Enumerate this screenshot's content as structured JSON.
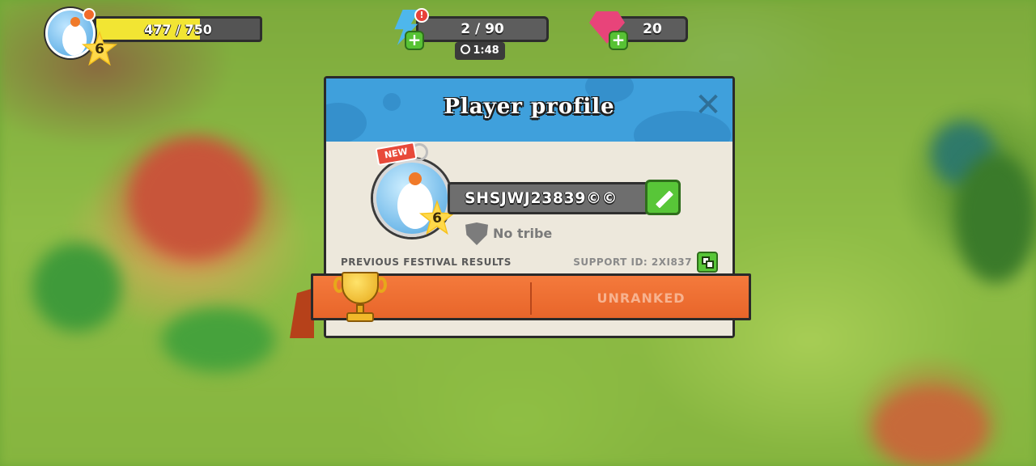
{
  "hud": {
    "xp_text": "477 / 750",
    "xp_progress": 0.636,
    "level": "6",
    "energy_text": "2 / 90",
    "energy_timer": "1:48",
    "gems": "20"
  },
  "dialog": {
    "title": "Player profile",
    "new_badge": "NEW",
    "player_level": "6",
    "player_name": "SHSJWJ23839©©",
    "tribe": "No tribe",
    "festival_label": "PREVIOUS FESTIVAL RESULTS",
    "support_label": "SUPPORT ID: 2XI837",
    "festival_rank": "UNRANKED",
    "close_glyph": "✕"
  },
  "colors": {
    "header_blue": "#3fa0dc",
    "ribbon_orange": "#f47a3c",
    "button_green": "#58c638",
    "xp_yellow": "#f2e533"
  },
  "icons": [
    "chicken-avatar-icon",
    "star-level-icon",
    "lightning-icon",
    "gem-icon",
    "plus-icon",
    "clock-icon",
    "close-icon",
    "pencil-icon",
    "shield-icon",
    "copy-icon",
    "trophy-icon"
  ]
}
